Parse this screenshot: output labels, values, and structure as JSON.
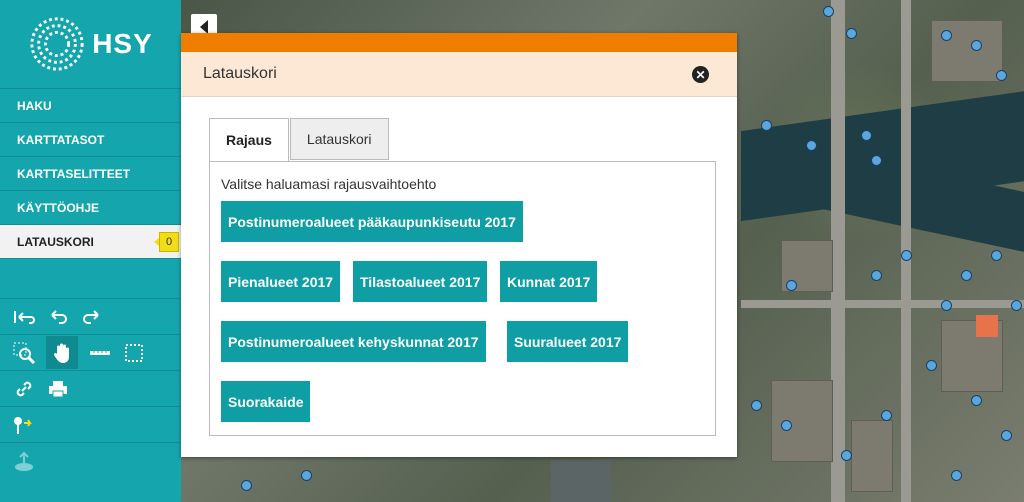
{
  "sidebar": {
    "logo_text": "HSY",
    "menu": [
      {
        "label": "HAKU"
      },
      {
        "label": "KARTTATASOT"
      },
      {
        "label": "KARTTASELITTEET"
      },
      {
        "label": "KÄYTTÖOHJE"
      },
      {
        "label": "LATAUSKORI",
        "badge": "0"
      }
    ],
    "tools": [
      "undo-all-icon",
      "undo-icon",
      "redo-icon",
      "zoom-box-icon",
      "pan-hand-icon",
      "measure-line-icon",
      "measure-area-icon",
      "link-icon",
      "print-icon",
      "marker-icon",
      "upload-icon"
    ]
  },
  "dialog": {
    "title": "Latauskori",
    "tabs": [
      "Rajaus",
      "Latauskori"
    ],
    "intro": "Valitse haluamasi rajausvaihtoehto",
    "options": [
      "Postinumeroalueet pääkaupunkiseutu 2017",
      "Pienalueet 2017",
      "Tilastoalueet 2017",
      "Kunnat 2017",
      "Postinumeroalueet kehyskunnat 2017",
      "Suuralueet 2017",
      "Suorakaide"
    ]
  },
  "colors": {
    "sidebar": "#15a5ad",
    "dialog_accent": "#ef7d00",
    "button": "#0f9ea4",
    "badge": "#f2de17"
  }
}
